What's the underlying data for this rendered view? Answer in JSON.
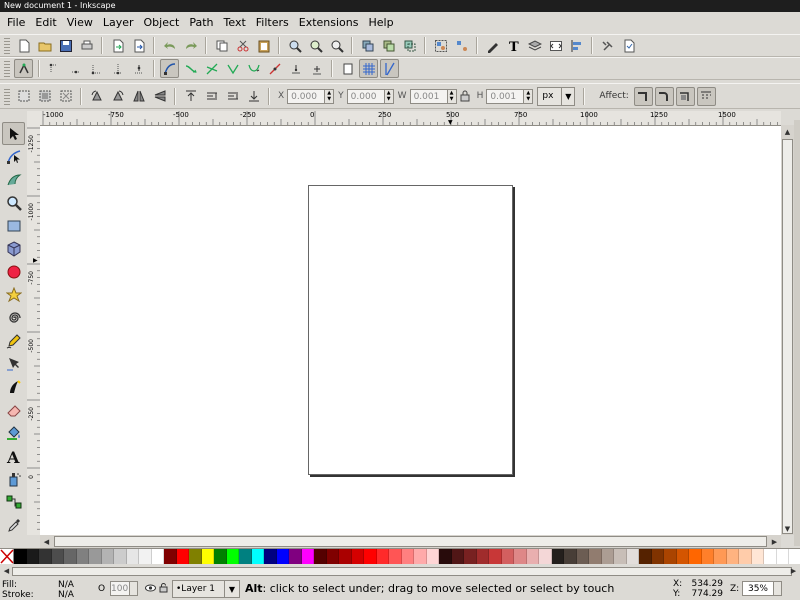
{
  "window": {
    "title": "New document 1 - Inkscape"
  },
  "menu": [
    "File",
    "Edit",
    "View",
    "Layer",
    "Object",
    "Path",
    "Text",
    "Filters",
    "Extensions",
    "Help"
  ],
  "select_toolbar": {
    "x_label": "X",
    "x_value": "0.000",
    "y_label": "Y",
    "y_value": "0.000",
    "w_label": "W",
    "w_value": "0.001",
    "h_label": "H",
    "h_value": "0.001",
    "unit": "px",
    "affect_label": "Affect:"
  },
  "ruler_h_labels": [
    "-1000",
    "-750",
    "-500",
    "-250",
    "0",
    "250",
    "500",
    "750",
    "1000",
    "1250",
    "1500"
  ],
  "ruler_v_labels": [
    "-1250",
    "-1000",
    "-750",
    "-500",
    "-250",
    "0"
  ],
  "status": {
    "fill_label": "Fill:",
    "fill_value": "N/A",
    "stroke_label": "Stroke:",
    "stroke_value": "N/A",
    "opacity_label": "O",
    "opacity_value": "100",
    "layer_name": "•Layer 1",
    "message_bold": "Alt",
    "message_rest": ": click to select under; drag to move selected or select by touch",
    "x_label": "X:",
    "x_value": "534.29",
    "y_label": "Y:",
    "y_value": "774.29",
    "zoom_label": "Z:",
    "zoom_value": "35%"
  },
  "palette": [
    "#000000",
    "#1a1a1a",
    "#333333",
    "#4d4d4d",
    "#666666",
    "#808080",
    "#999999",
    "#b3b3b3",
    "#cccccc",
    "#e6e6e6",
    "#f2f2f2",
    "#ffffff",
    "#800000",
    "#ff0000",
    "#808000",
    "#ffff00",
    "#008000",
    "#00ff00",
    "#008080",
    "#00ffff",
    "#000080",
    "#0000ff",
    "#800080",
    "#ff00ff",
    "#550000",
    "#800000",
    "#aa0000",
    "#d40000",
    "#ff0000",
    "#ff2a2a",
    "#ff5555",
    "#ff8080",
    "#ffaaaa",
    "#ffd5d5",
    "#280b0b",
    "#501616",
    "#782121",
    "#a02c2c",
    "#c83737",
    "#d35f5f",
    "#de8787",
    "#e9afaf",
    "#f4d7d7",
    "#241f1c",
    "#483e37",
    "#6c5d53",
    "#917c6f",
    "#ac9d93",
    "#c8beb7",
    "#e3dedb",
    "#552200",
    "#803300",
    "#aa4400",
    "#d45500",
    "#ff6600",
    "#ff7f2a",
    "#ff9955",
    "#ffb380",
    "#ffccaa",
    "#ffe6d5",
    "#ffffff",
    "#ffffff",
    "#ffffff",
    "#ffffff"
  ]
}
